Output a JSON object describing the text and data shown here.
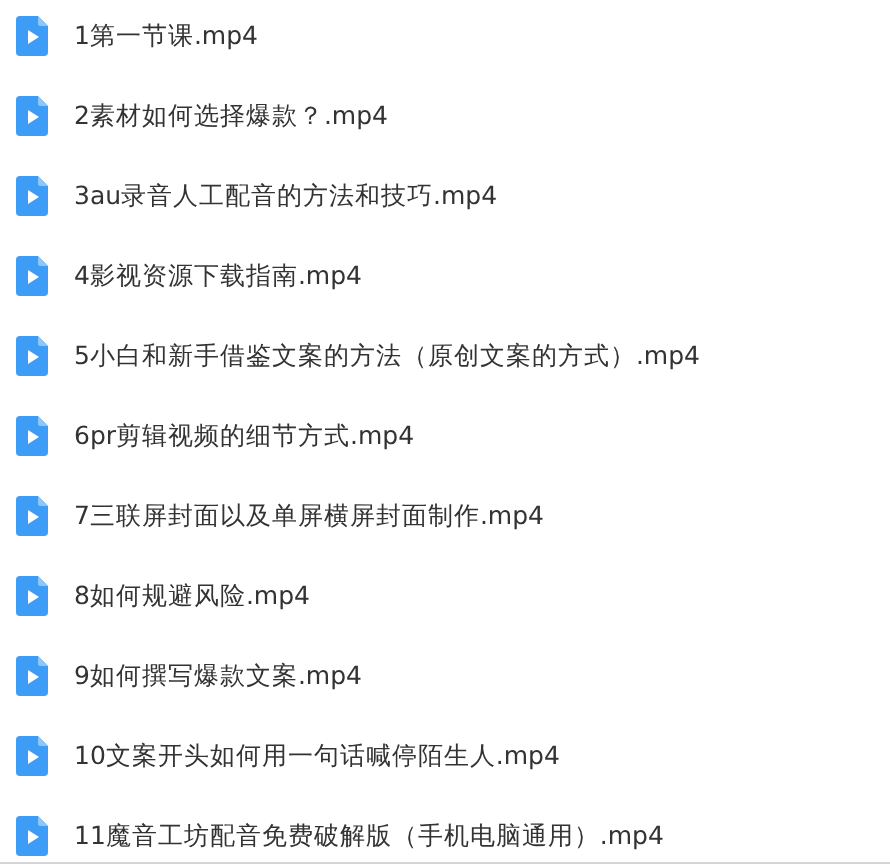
{
  "files": [
    {
      "name": "1第一节课.mp4"
    },
    {
      "name": "2素材如何选择爆款？.mp4"
    },
    {
      "name": "3au录音人工配音的方法和技巧.mp4"
    },
    {
      "name": "4影视资源下载指南.mp4"
    },
    {
      "name": "5小白和新手借鉴文案的方法（原创文案的方式）.mp4"
    },
    {
      "name": "6pr剪辑视频的细节方式.mp4"
    },
    {
      "name": "7三联屏封面以及单屏横屏封面制作.mp4"
    },
    {
      "name": "8如何规避风险.mp4"
    },
    {
      "name": "9如何撰写爆款文案.mp4"
    },
    {
      "name": "10文案开头如何用一句话喊停陌生人.mp4"
    },
    {
      "name": "11魔音工坊配音免费破解版（手机电脑通用）.mp4"
    }
  ]
}
